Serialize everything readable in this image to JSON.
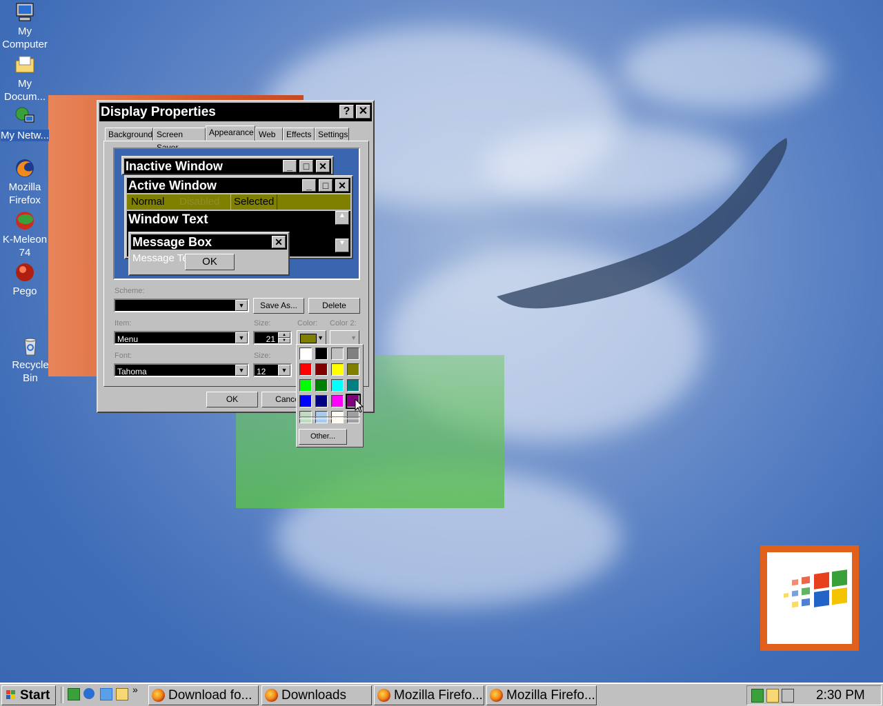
{
  "desktop": {
    "icons": [
      {
        "label": "My Computer",
        "icon": "my-computer-icon"
      },
      {
        "label": "My Docum...",
        "icon": "my-documents-icon"
      },
      {
        "label": "My Netw...",
        "icon": "network-icon"
      },
      {
        "label": "Mozilla Firefox",
        "icon": "firefox-icon"
      },
      {
        "label": "K-Meleon 74",
        "icon": "kmeleon-icon"
      },
      {
        "label": "Pego",
        "icon": "pego-icon"
      },
      {
        "label": "Recycle Bin",
        "icon": "recycle-bin-icon"
      }
    ]
  },
  "dialog": {
    "title": "Display Properties",
    "help_glyph": "?",
    "close_glyph": "✕",
    "tabs": [
      "Background",
      "Screen Saver",
      "Appearance",
      "Web",
      "Effects",
      "Settings"
    ],
    "active_tab": "Appearance",
    "preview": {
      "inactive_title": "Inactive Window",
      "active_title": "Active Window",
      "menu_normal": "Normal",
      "menu_disabled": "Disabled",
      "menu_selected": "Selected",
      "window_text": "Window Text",
      "message_box_title": "Message Box",
      "message_text": "Message Text",
      "ok": "OK"
    },
    "scheme_label": "Scheme:",
    "scheme_value": "",
    "save_as": "Save As...",
    "delete": "Delete",
    "item_label": "Item:",
    "item_value": "Menu",
    "size_label": "Size:",
    "size_value": "21",
    "color_label": "Color:",
    "color2_label": "Color 2:",
    "font_label": "Font:",
    "font_value": "Tahoma",
    "font_size_label": "Size:",
    "font_size_value": "12",
    "ok": "OK",
    "cancel": "Cance",
    "current_color": "#808000"
  },
  "color_picker": {
    "colors": [
      "#ffffff",
      "#000000",
      "#c0c0c0",
      "#808080",
      "#ff0000",
      "#800000",
      "#ffff00",
      "#808000",
      "#00ff00",
      "#008000",
      "#00ffff",
      "#008080",
      "#0000ff",
      "#000080",
      "#ff00ff",
      "#800080",
      "#c0dcc0",
      "#a6caf0",
      "#fffbf0",
      "#a0a0a4"
    ],
    "selected": "#800080",
    "other": "Other..."
  },
  "taskbar": {
    "start": "Start",
    "items": [
      "Download fo...",
      "Downloads",
      "Mozilla Firefo...",
      "Mozilla Firefo..."
    ],
    "clock": "2:30 PM"
  }
}
